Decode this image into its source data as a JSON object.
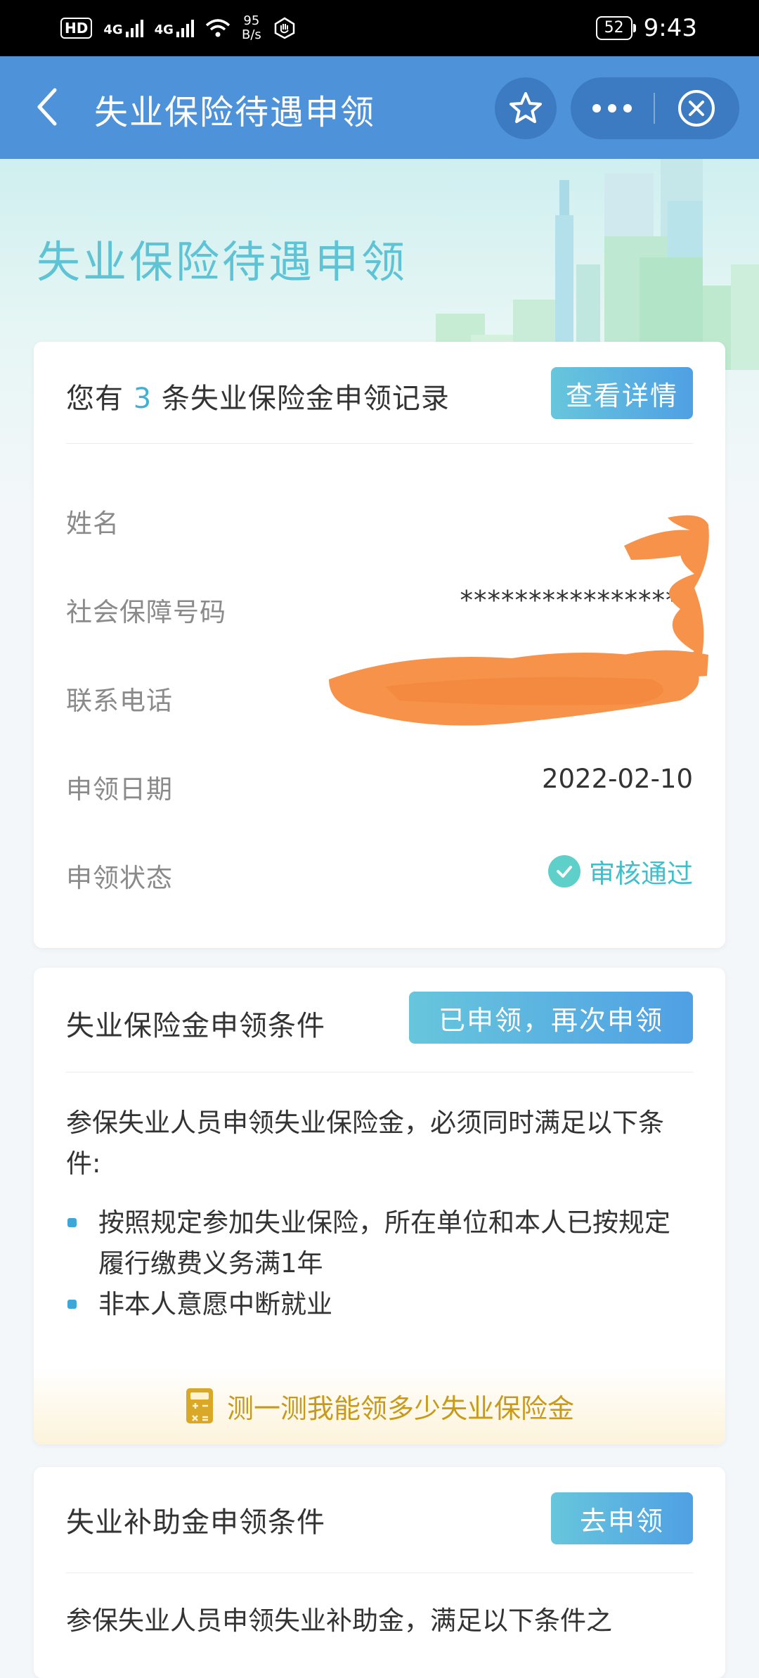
{
  "status_bar": {
    "hd": "HD",
    "sim1_type": "4G",
    "sim2_type": "4G",
    "speed_value": "95",
    "speed_unit": "B/s",
    "battery": "52",
    "time": "9:43"
  },
  "nav": {
    "title": "失业保险待遇申领"
  },
  "hero": {
    "title": "失业保险待遇申领"
  },
  "records_card": {
    "prefix": "您有",
    "count": "3",
    "suffix": "条失业保险金申领记录",
    "details_button": "查看详情",
    "rows": {
      "name_label": "姓名",
      "ssn_label": "社会保障号码",
      "ssn_value": "*****************",
      "phone_label": "联系电话",
      "date_label": "申领日期",
      "date_value": "2022-02-10",
      "status_label": "申领状态",
      "status_value": "审核通过"
    }
  },
  "benefit_card": {
    "title": "失业保险金申领条件",
    "button": "已申领，再次申领",
    "intro": "参保失业人员申领失业保险金，必须同时满足以下条件:",
    "items": [
      "按照规定参加失业保险，所在单位和本人已按规定履行缴费义务满1年",
      "非本人意愿中断就业"
    ],
    "calc_link": "测一测我能领多少失业保险金"
  },
  "subsidy_card": {
    "title": "失业补助金申领条件",
    "button": "去申领",
    "intro": "参保失业人员申领失业补助金，满足以下条件之"
  },
  "colors": {
    "nav_bg": "#4e92d9",
    "accent": "#3fb0d6",
    "status_ok": "#3fbfcc",
    "calc_gold": "#c79a1b"
  }
}
